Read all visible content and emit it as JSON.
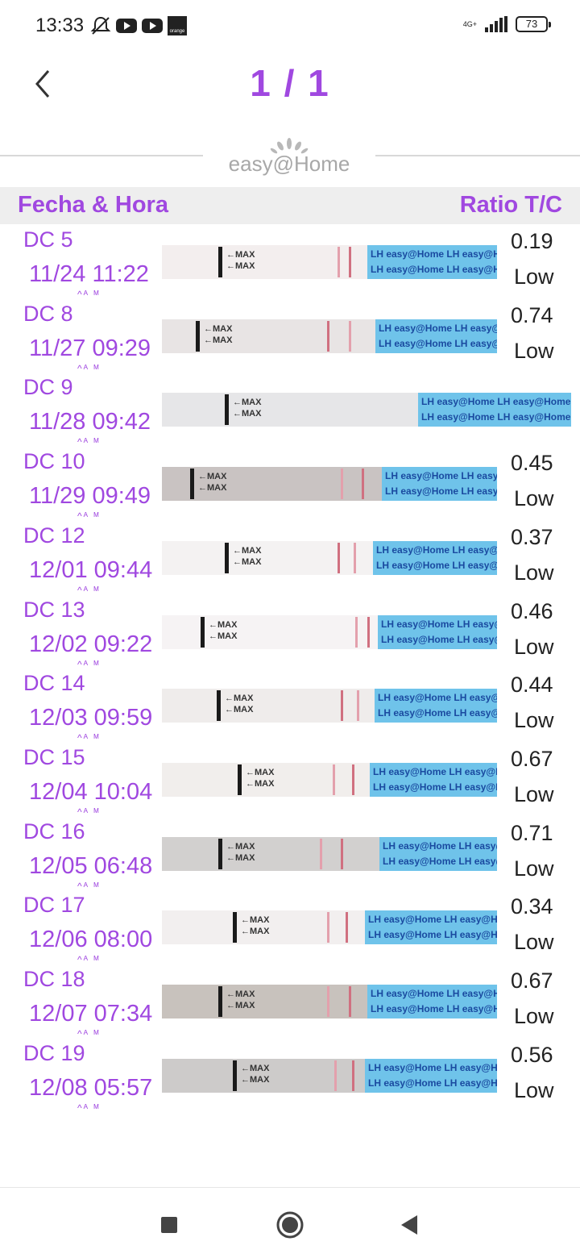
{
  "status_bar": {
    "time": "13:33",
    "network": "4G+",
    "battery": "73",
    "carrier_badge": "orange"
  },
  "header": {
    "page_indicator": "1 / 1",
    "back_icon": "chevron-left-icon"
  },
  "brand": {
    "logo_text": "easy@Home"
  },
  "table_header": {
    "date_label": "Fecha & Hora",
    "ratio_label": "Ratio T/C"
  },
  "strip_labels": {
    "max": "←MAX",
    "lh": "LH easy@Home LH easy@Home LH"
  },
  "rows": [
    {
      "dc": "DC 5",
      "datetime": "11/24 11:22",
      "meridiem": "^ᴬ ᴹ",
      "ratio": "0.19",
      "level": "Low"
    },
    {
      "dc": "DC 8",
      "datetime": "11/27 09:29",
      "meridiem": "^ᴬ ᴹ",
      "ratio": "0.74",
      "level": "Low"
    },
    {
      "dc": "DC 9",
      "datetime": "11/28 09:42",
      "meridiem": "^ᴬ ᴹ",
      "ratio": "",
      "level": ""
    },
    {
      "dc": "DC 10",
      "datetime": "11/29 09:49",
      "meridiem": "^ᴬ ᴹ",
      "ratio": "0.45",
      "level": "Low"
    },
    {
      "dc": "DC 12",
      "datetime": "12/01 09:44",
      "meridiem": "^ᴬ ᴹ",
      "ratio": "0.37",
      "level": "Low"
    },
    {
      "dc": "DC 13",
      "datetime": "12/02 09:22",
      "meridiem": "^ᴬ ᴹ",
      "ratio": "0.46",
      "level": "Low"
    },
    {
      "dc": "DC 14",
      "datetime": "12/03 09:59",
      "meridiem": "^ᴬ ᴹ",
      "ratio": "0.44",
      "level": "Low"
    },
    {
      "dc": "DC 15",
      "datetime": "12/04 10:04",
      "meridiem": "^ᴬ ᴹ",
      "ratio": "0.67",
      "level": "Low"
    },
    {
      "dc": "DC 16",
      "datetime": "12/05 06:48",
      "meridiem": "^ᴬ ᴹ",
      "ratio": "0.71",
      "level": "Low"
    },
    {
      "dc": "DC 17",
      "datetime": "12/06 08:00",
      "meridiem": "^ᴬ ᴹ",
      "ratio": "0.34",
      "level": "Low"
    },
    {
      "dc": "DC 18",
      "datetime": "12/07 07:34",
      "meridiem": "^ᴬ ᴹ",
      "ratio": "0.67",
      "level": "Low"
    },
    {
      "dc": "DC 19",
      "datetime": "12/08 05:57",
      "meridiem": "^ᴬ ᴹ",
      "ratio": "0.56",
      "level": "Low"
    }
  ],
  "nav": {
    "recents_icon": "square-icon",
    "home_icon": "circle-home-icon",
    "back_icon": "triangle-back-icon"
  },
  "colors": {
    "accent": "#a048e0",
    "header_bg": "#eeeeee",
    "strip_blue": "#6fc3ea"
  }
}
